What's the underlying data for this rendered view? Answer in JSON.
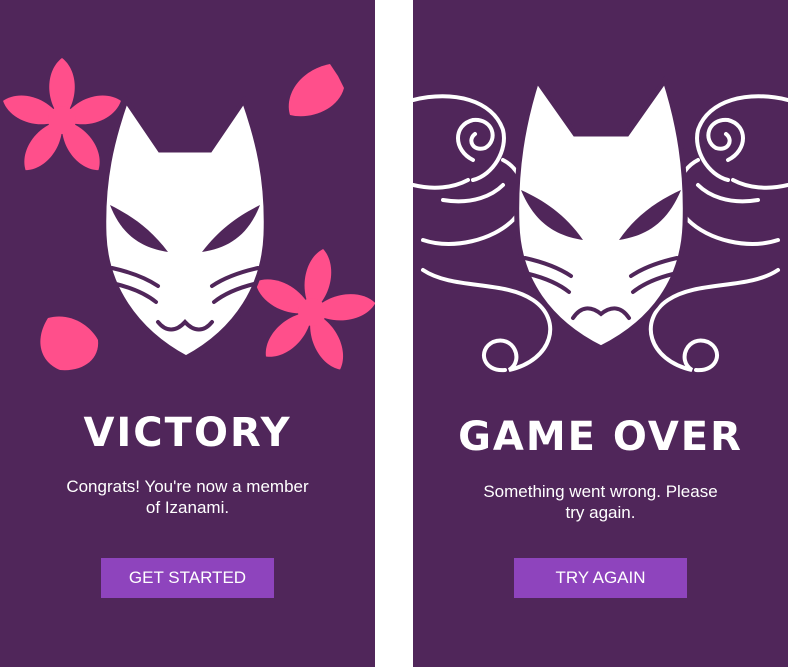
{
  "victory": {
    "title": "VICTORY",
    "message": "Congrats! You're now a member of Izanami.",
    "button_label": "GET STARTED"
  },
  "game_over": {
    "title": "GAME OVER",
    "message": "Something went wrong. Please try again.",
    "button_label": "TRY AGAIN"
  },
  "colors": {
    "background": "#50265a",
    "button": "#8e44bd",
    "blossom": "#ff4f8b",
    "mask": "#ffffff"
  },
  "icons": {
    "victory_art": [
      "kitsune-mask-icon",
      "cherry-blossom-icon"
    ],
    "game_over_art": [
      "kitsune-mask-icon",
      "smoke-swirl-icon"
    ]
  }
}
